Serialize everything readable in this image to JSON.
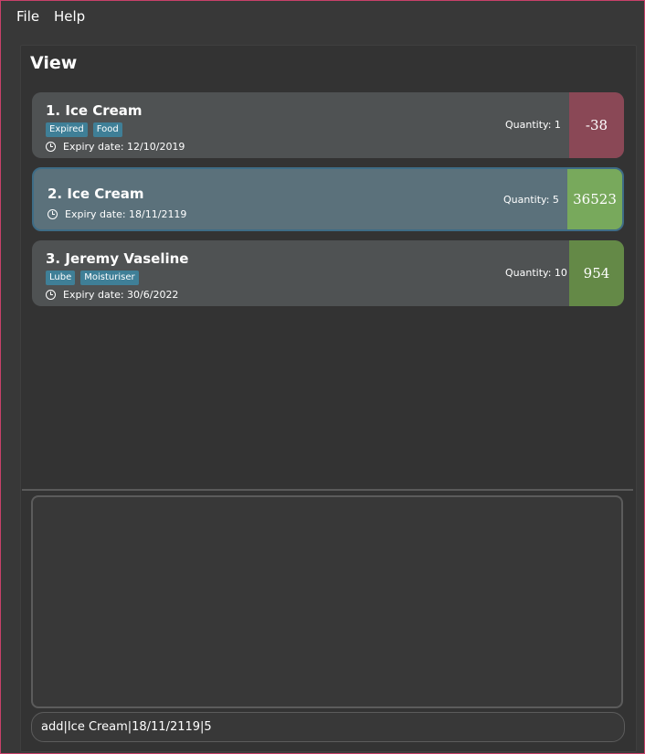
{
  "menu": {
    "file": "File",
    "help": "Help"
  },
  "view": {
    "title": "View"
  },
  "items": [
    {
      "title": "1.  Ice Cream",
      "tags": [
        "Expired",
        "Food"
      ],
      "expiry": "Expiry date: 12/10/2019",
      "quantity": "Quantity: 1",
      "days": "-38",
      "days_color": "#8a4856",
      "selected": false
    },
    {
      "title": "2.  Ice Cream",
      "tags": [],
      "expiry": "Expiry date: 18/11/2119",
      "quantity": "Quantity: 5",
      "days": "36523",
      "days_color": "#78a95c",
      "selected": true
    },
    {
      "title": "3.  Jeremy Vaseline",
      "tags": [
        "Lube",
        "Moisturiser"
      ],
      "expiry": "Expiry date: 30/6/2022",
      "quantity": "Quantity: 10",
      "days": "954",
      "days_color": "#648947",
      "selected": false
    }
  ],
  "result": {
    "text": ""
  },
  "command": {
    "value": "add|Ice Cream|18/11/2119|5",
    "placeholder": ""
  },
  "colors": {
    "accent": "#3f7f97",
    "expired": "#8a4856",
    "fresh": "#648947",
    "frame": "#c8416a"
  }
}
